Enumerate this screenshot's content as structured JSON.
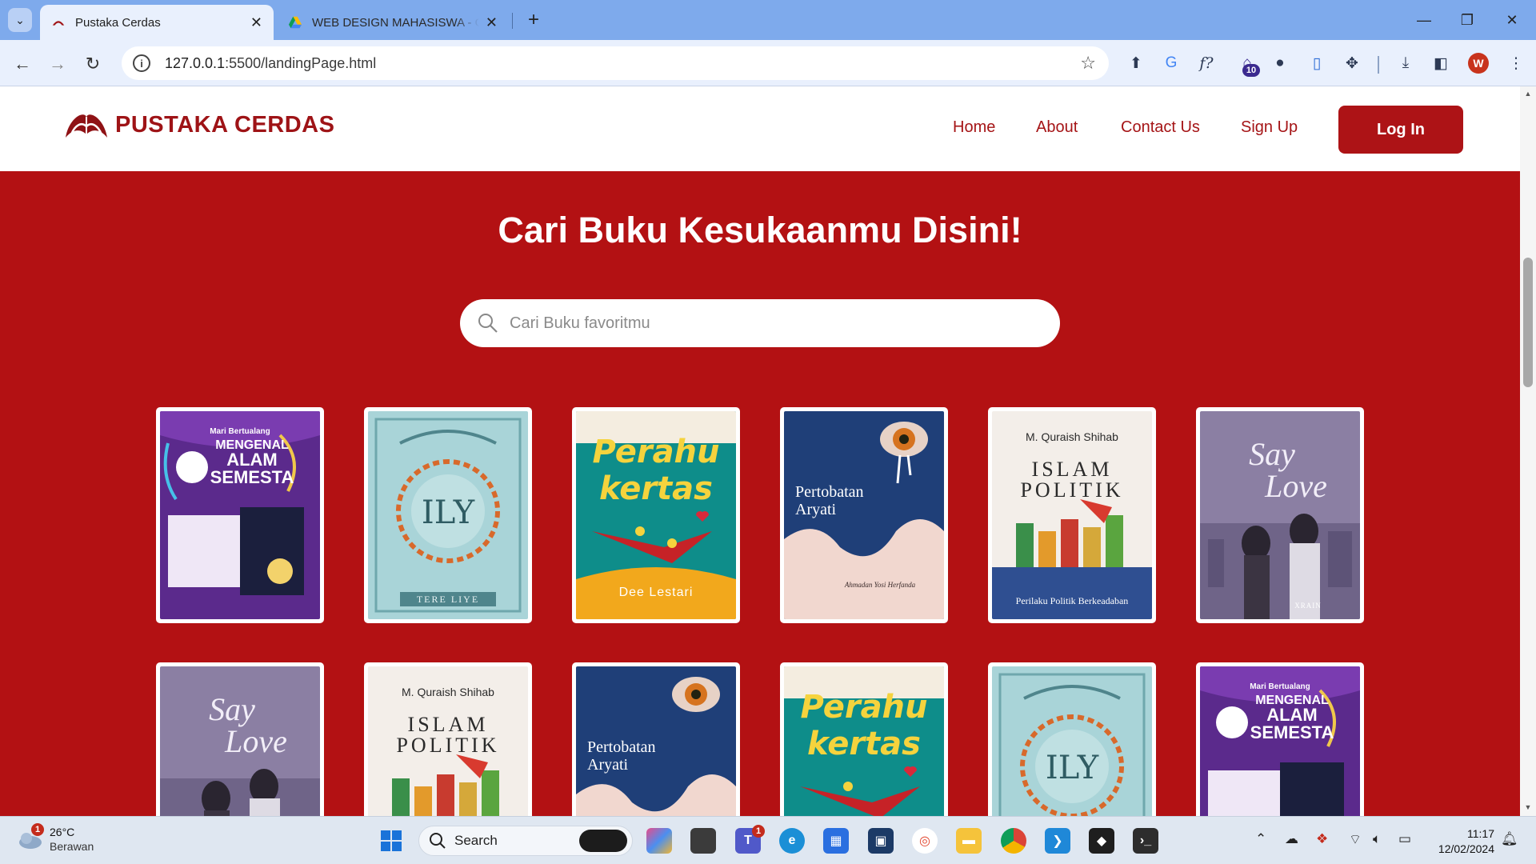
{
  "browser": {
    "tabs": [
      {
        "title": "Pustaka Cerdas",
        "active": true
      },
      {
        "title": "WEB DESIGN MAHASISWA - Go",
        "active": false
      }
    ],
    "url_host": "127.0.0.1",
    "url_rest": ":5500/landingPage.html",
    "extension_badge": "10",
    "profile_initial": "W"
  },
  "site": {
    "brand": "PUSTAKA CERDAS",
    "nav": [
      "Home",
      "About",
      "Contact Us",
      "Sign Up"
    ],
    "login_label": "Log In",
    "hero_title": "Cari Buku Kesukaanmu Disini!",
    "search_placeholder": "Cari Buku favoritmu",
    "colors": {
      "primary": "#b31113",
      "brand_text": "#9e1316",
      "nav_text": "#a51416"
    }
  },
  "books": {
    "row1": [
      {
        "cover": "alam",
        "lines": [
          "Mari Bertualang",
          "MENGENAL",
          "ALAM",
          "SEMESTA"
        ]
      },
      {
        "cover": "ily",
        "lines": [
          "TERE LIYE"
        ]
      },
      {
        "cover": "perahu",
        "lines": [
          "Perahu",
          "kertas",
          "Dee Lestari"
        ]
      },
      {
        "cover": "aryati",
        "lines": [
          "Pertobatan",
          "Aryati",
          "Ahmadan Yosi Herfanda"
        ]
      },
      {
        "cover": "islam",
        "lines": [
          "M. Quraish Shihab",
          "ISLAM",
          "POLITIK",
          "Perilaku Politik Berkeadaban"
        ]
      },
      {
        "cover": "saylove",
        "lines": [
          "Say",
          "Love",
          "XRAIN"
        ]
      }
    ],
    "row2": [
      {
        "cover": "saylove",
        "lines": [
          "Say",
          "Love"
        ]
      },
      {
        "cover": "islam",
        "lines": [
          "M. Quraish Shihab",
          "ISLAM",
          "POLITIK"
        ]
      },
      {
        "cover": "aryati",
        "lines": [
          "Pertobatan",
          "Aryati"
        ]
      },
      {
        "cover": "perahu",
        "lines": [
          "Perahu",
          "kertas"
        ]
      },
      {
        "cover": "ily",
        "lines": []
      },
      {
        "cover": "alam",
        "lines": [
          "Mari Bertualang",
          "MENGENAL",
          "ALAM",
          "SEMESTA"
        ]
      }
    ]
  },
  "taskbar": {
    "temperature": "26°C",
    "condition": "Berawan",
    "weather_badge": "1",
    "search_label": "Search",
    "teams_badge": "1",
    "time": "11:17",
    "date": "12/02/2024"
  }
}
